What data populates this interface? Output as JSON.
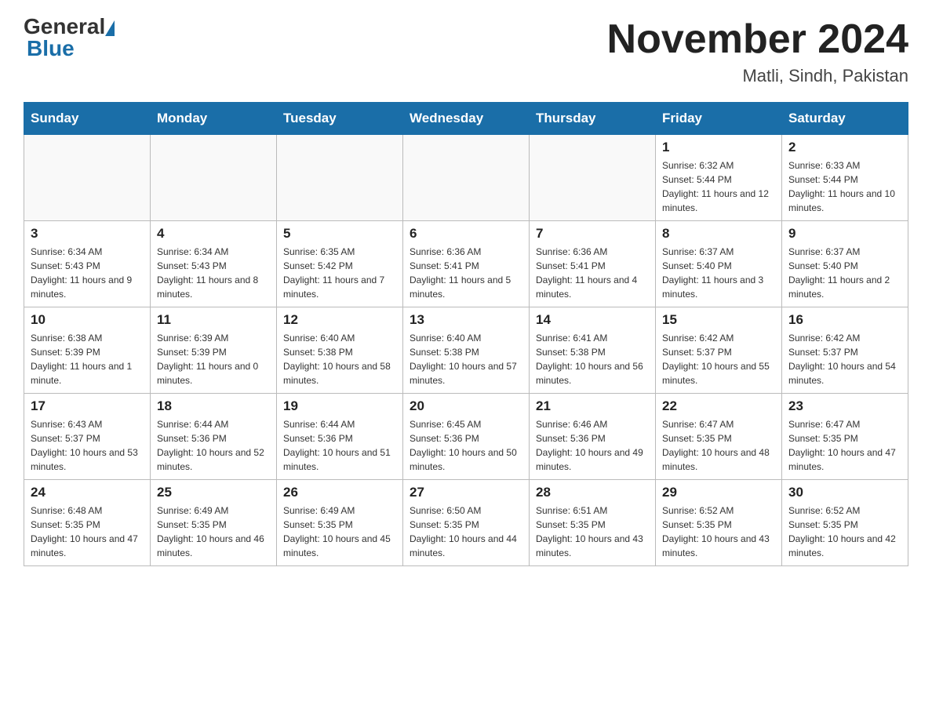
{
  "header": {
    "logo": {
      "text_general": "General",
      "text_blue": "Blue"
    },
    "month": "November 2024",
    "location": "Matli, Sindh, Pakistan"
  },
  "weekdays": [
    "Sunday",
    "Monday",
    "Tuesday",
    "Wednesday",
    "Thursday",
    "Friday",
    "Saturday"
  ],
  "weeks": [
    [
      {
        "day": "",
        "sunrise": "",
        "sunset": "",
        "daylight": ""
      },
      {
        "day": "",
        "sunrise": "",
        "sunset": "",
        "daylight": ""
      },
      {
        "day": "",
        "sunrise": "",
        "sunset": "",
        "daylight": ""
      },
      {
        "day": "",
        "sunrise": "",
        "sunset": "",
        "daylight": ""
      },
      {
        "day": "",
        "sunrise": "",
        "sunset": "",
        "daylight": ""
      },
      {
        "day": "1",
        "sunrise": "Sunrise: 6:32 AM",
        "sunset": "Sunset: 5:44 PM",
        "daylight": "Daylight: 11 hours and 12 minutes."
      },
      {
        "day": "2",
        "sunrise": "Sunrise: 6:33 AM",
        "sunset": "Sunset: 5:44 PM",
        "daylight": "Daylight: 11 hours and 10 minutes."
      }
    ],
    [
      {
        "day": "3",
        "sunrise": "Sunrise: 6:34 AM",
        "sunset": "Sunset: 5:43 PM",
        "daylight": "Daylight: 11 hours and 9 minutes."
      },
      {
        "day": "4",
        "sunrise": "Sunrise: 6:34 AM",
        "sunset": "Sunset: 5:43 PM",
        "daylight": "Daylight: 11 hours and 8 minutes."
      },
      {
        "day": "5",
        "sunrise": "Sunrise: 6:35 AM",
        "sunset": "Sunset: 5:42 PM",
        "daylight": "Daylight: 11 hours and 7 minutes."
      },
      {
        "day": "6",
        "sunrise": "Sunrise: 6:36 AM",
        "sunset": "Sunset: 5:41 PM",
        "daylight": "Daylight: 11 hours and 5 minutes."
      },
      {
        "day": "7",
        "sunrise": "Sunrise: 6:36 AM",
        "sunset": "Sunset: 5:41 PM",
        "daylight": "Daylight: 11 hours and 4 minutes."
      },
      {
        "day": "8",
        "sunrise": "Sunrise: 6:37 AM",
        "sunset": "Sunset: 5:40 PM",
        "daylight": "Daylight: 11 hours and 3 minutes."
      },
      {
        "day": "9",
        "sunrise": "Sunrise: 6:37 AM",
        "sunset": "Sunset: 5:40 PM",
        "daylight": "Daylight: 11 hours and 2 minutes."
      }
    ],
    [
      {
        "day": "10",
        "sunrise": "Sunrise: 6:38 AM",
        "sunset": "Sunset: 5:39 PM",
        "daylight": "Daylight: 11 hours and 1 minute."
      },
      {
        "day": "11",
        "sunrise": "Sunrise: 6:39 AM",
        "sunset": "Sunset: 5:39 PM",
        "daylight": "Daylight: 11 hours and 0 minutes."
      },
      {
        "day": "12",
        "sunrise": "Sunrise: 6:40 AM",
        "sunset": "Sunset: 5:38 PM",
        "daylight": "Daylight: 10 hours and 58 minutes."
      },
      {
        "day": "13",
        "sunrise": "Sunrise: 6:40 AM",
        "sunset": "Sunset: 5:38 PM",
        "daylight": "Daylight: 10 hours and 57 minutes."
      },
      {
        "day": "14",
        "sunrise": "Sunrise: 6:41 AM",
        "sunset": "Sunset: 5:38 PM",
        "daylight": "Daylight: 10 hours and 56 minutes."
      },
      {
        "day": "15",
        "sunrise": "Sunrise: 6:42 AM",
        "sunset": "Sunset: 5:37 PM",
        "daylight": "Daylight: 10 hours and 55 minutes."
      },
      {
        "day": "16",
        "sunrise": "Sunrise: 6:42 AM",
        "sunset": "Sunset: 5:37 PM",
        "daylight": "Daylight: 10 hours and 54 minutes."
      }
    ],
    [
      {
        "day": "17",
        "sunrise": "Sunrise: 6:43 AM",
        "sunset": "Sunset: 5:37 PM",
        "daylight": "Daylight: 10 hours and 53 minutes."
      },
      {
        "day": "18",
        "sunrise": "Sunrise: 6:44 AM",
        "sunset": "Sunset: 5:36 PM",
        "daylight": "Daylight: 10 hours and 52 minutes."
      },
      {
        "day": "19",
        "sunrise": "Sunrise: 6:44 AM",
        "sunset": "Sunset: 5:36 PM",
        "daylight": "Daylight: 10 hours and 51 minutes."
      },
      {
        "day": "20",
        "sunrise": "Sunrise: 6:45 AM",
        "sunset": "Sunset: 5:36 PM",
        "daylight": "Daylight: 10 hours and 50 minutes."
      },
      {
        "day": "21",
        "sunrise": "Sunrise: 6:46 AM",
        "sunset": "Sunset: 5:36 PM",
        "daylight": "Daylight: 10 hours and 49 minutes."
      },
      {
        "day": "22",
        "sunrise": "Sunrise: 6:47 AM",
        "sunset": "Sunset: 5:35 PM",
        "daylight": "Daylight: 10 hours and 48 minutes."
      },
      {
        "day": "23",
        "sunrise": "Sunrise: 6:47 AM",
        "sunset": "Sunset: 5:35 PM",
        "daylight": "Daylight: 10 hours and 47 minutes."
      }
    ],
    [
      {
        "day": "24",
        "sunrise": "Sunrise: 6:48 AM",
        "sunset": "Sunset: 5:35 PM",
        "daylight": "Daylight: 10 hours and 47 minutes."
      },
      {
        "day": "25",
        "sunrise": "Sunrise: 6:49 AM",
        "sunset": "Sunset: 5:35 PM",
        "daylight": "Daylight: 10 hours and 46 minutes."
      },
      {
        "day": "26",
        "sunrise": "Sunrise: 6:49 AM",
        "sunset": "Sunset: 5:35 PM",
        "daylight": "Daylight: 10 hours and 45 minutes."
      },
      {
        "day": "27",
        "sunrise": "Sunrise: 6:50 AM",
        "sunset": "Sunset: 5:35 PM",
        "daylight": "Daylight: 10 hours and 44 minutes."
      },
      {
        "day": "28",
        "sunrise": "Sunrise: 6:51 AM",
        "sunset": "Sunset: 5:35 PM",
        "daylight": "Daylight: 10 hours and 43 minutes."
      },
      {
        "day": "29",
        "sunrise": "Sunrise: 6:52 AM",
        "sunset": "Sunset: 5:35 PM",
        "daylight": "Daylight: 10 hours and 43 minutes."
      },
      {
        "day": "30",
        "sunrise": "Sunrise: 6:52 AM",
        "sunset": "Sunset: 5:35 PM",
        "daylight": "Daylight: 10 hours and 42 minutes."
      }
    ]
  ]
}
